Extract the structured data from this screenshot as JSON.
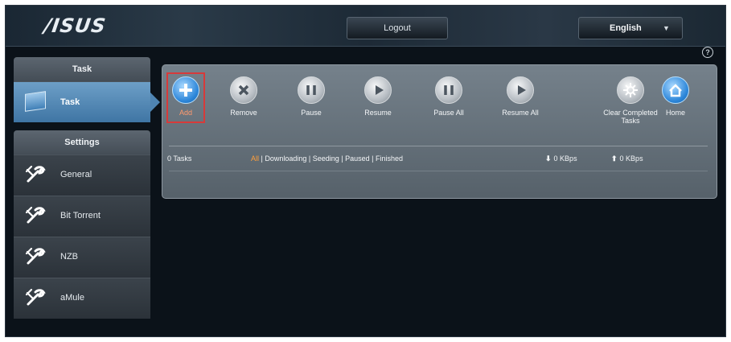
{
  "header": {
    "logo_text": "/ISUS",
    "logout_label": "Logout",
    "language": "English"
  },
  "sidebar": {
    "task_section": "Task",
    "task_item": "Task",
    "settings_section": "Settings",
    "settings_items": [
      "General",
      "Bit Torrent",
      "NZB",
      "aMule"
    ]
  },
  "toolbar": {
    "buttons": [
      {
        "label": "Add",
        "icon": "plus-icon"
      },
      {
        "label": "Remove",
        "icon": "remove-icon"
      },
      {
        "label": "Pause",
        "icon": "pause-icon"
      },
      {
        "label": "Resume",
        "icon": "resume-icon"
      },
      {
        "label": "Pause All",
        "icon": "pause-all-icon"
      },
      {
        "label": "Resume All",
        "icon": "resume-all-icon"
      },
      {
        "label": "Clear Completed Tasks",
        "icon": "clear-completed-icon"
      },
      {
        "label": "Home",
        "icon": "home-icon"
      }
    ]
  },
  "status": {
    "task_count": "0 Tasks",
    "filters": [
      "All",
      "Downloading",
      "Seeding",
      "Paused",
      "Finished"
    ],
    "active_filter": "All",
    "download_speed": "0 KBps",
    "upload_speed": "0 KBps"
  },
  "colors": {
    "accent_red": "#d73a3a",
    "active_filter": "#ff9f3a",
    "sidebar_active": "#4f85b3"
  }
}
